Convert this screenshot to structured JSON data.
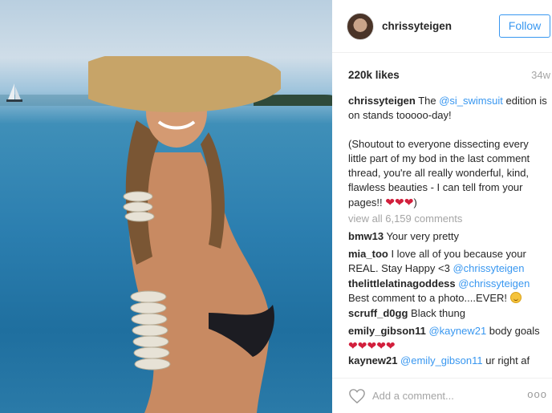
{
  "post": {
    "username": "chrissyteigen",
    "follow_label": "Follow",
    "likes": "220k likes",
    "time": "34w"
  },
  "caption": {
    "username": "chrissyteigen",
    "text_1": " The ",
    "mention": "@si_swimsuit",
    "text_2": " edition is on stands tooooo-day!",
    "paragraph_2": "(Shoutout to everyone dissecting every little part of my bod in the last comment thread, you're all really wonderful, kind, flawless beauties - I can tell from your pages!!",
    "hearts": "❤❤❤",
    "closing": ")"
  },
  "view_all": "view all 6,159 comments",
  "comments": [
    {
      "user": "bmw13",
      "text": " Your very pretty"
    },
    {
      "user": "mia_too",
      "text": " I love all of you because your REAL. Stay Happy <3 ",
      "mention": "@chrissyteigen"
    },
    {
      "user": "thelittlelatinagoddess",
      "mention": " @chrissyteigen",
      "text": "Best comment to a photo....EVER! "
    },
    {
      "user": "scruff_d0gg",
      "text": " Black thung"
    },
    {
      "user": "emily_gibson11",
      "mention": " @kaynew21",
      "text": " body goals",
      "hearts": "❤❤❤❤❤"
    },
    {
      "user": "kaynew21",
      "mention": " @emily_gibson11",
      "text": " ur right af"
    }
  ],
  "footer": {
    "add_comment_placeholder": "Add a comment...",
    "more_label": "ooo"
  },
  "colors": {
    "link": "#3897f0",
    "muted": "#a5a5a5",
    "heart": "#d21f3c"
  },
  "icons": {
    "like": "heart-outline-icon",
    "more": "more-options-icon"
  }
}
